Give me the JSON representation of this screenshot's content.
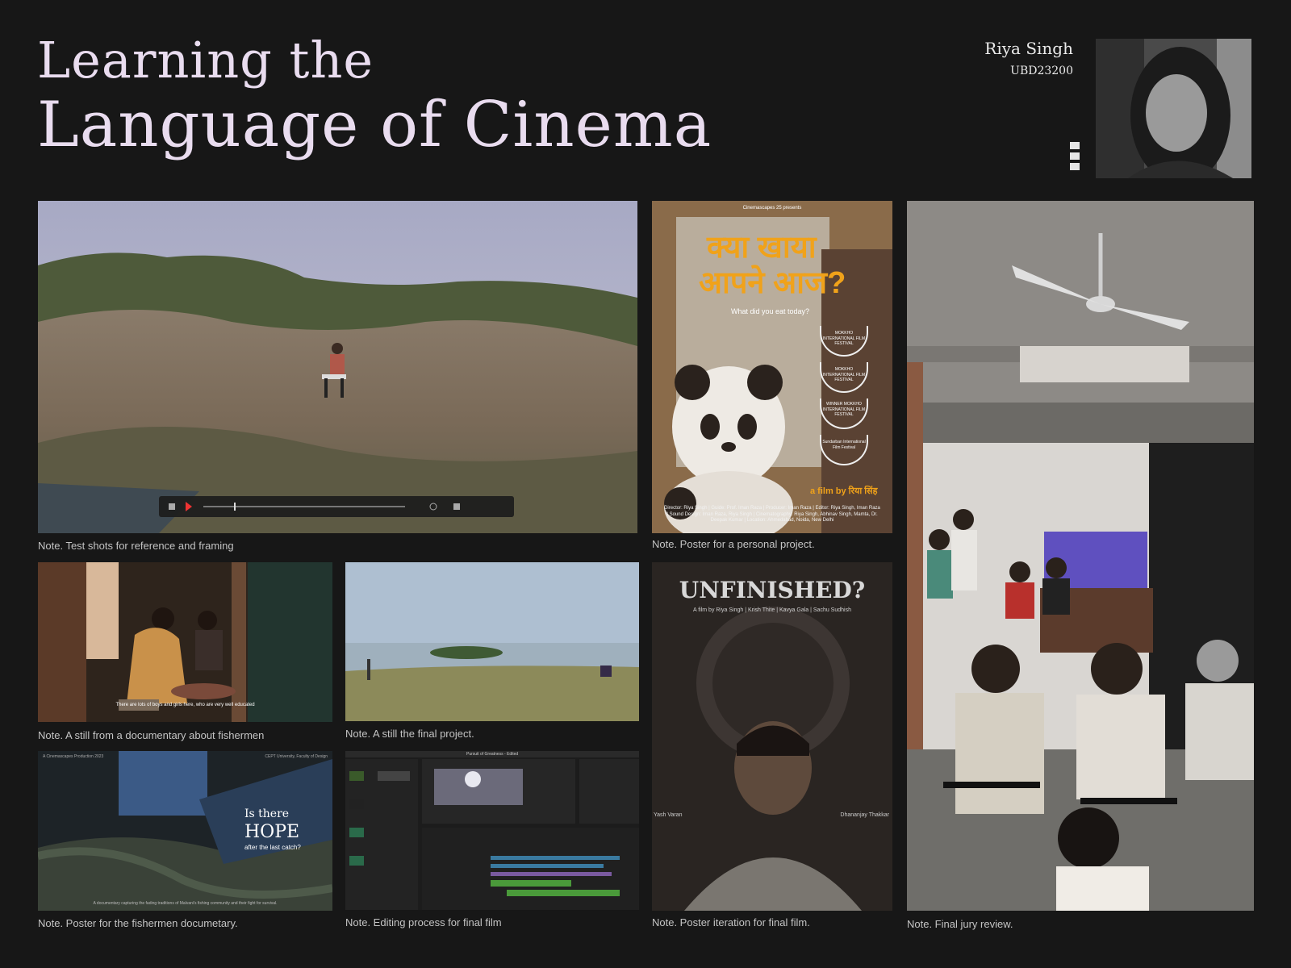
{
  "header": {
    "title_line1": "Learning the",
    "title_line2": "Language of Cinema",
    "author_name": "Riya Singh",
    "author_id": "UBD23200"
  },
  "panels": {
    "test_shots": {
      "caption": "Note. Test shots for reference and framing"
    },
    "poster_personal": {
      "presents": "Cinemascapes 25 presents",
      "hindi_title_line1": "क्या खाया",
      "hindi_title_line2": "आपने आज?",
      "subtitle": "What did you eat today?",
      "laurels": [
        "MOKKHO INTERNATIONAL FILM FESTIVAL",
        "MOKKHO INTERNATIONAL FILM FESTIVAL",
        "WINNER MOKKHO INTERNATIONAL FILM FESTIVAL",
        "Sundarban International Film Festival"
      ],
      "film_by": "a film by रिया सिंह",
      "credits": "Director: Riya Singh | Guide: Prof. Iman Raza | Producer: Iman Raza | Editor: Riya Singh, Iman Raza | Sound Design: Iman Raza, Riya Singh | Cinematography: Riya Singh, Abhinav Singh, Mamta, Dr. Deepak Kumar | Location: Ahmedabad, Noida, New Delhi",
      "caption": "Note. Poster for a personal project."
    },
    "fishermen_still": {
      "subtitle_text": "There are lots of boys and girls here, who are very well educated",
      "caption": "Note. A still from a documentary about fishermen"
    },
    "final_still": {
      "caption": "Note. A still the final project."
    },
    "poster_final": {
      "title": "UNFINISHED?",
      "byline": "A film by Riya Singh | Krish Thite | Kavya Gala | Sachu Sudhish",
      "left_name": "Yash Varan",
      "right_name": "Dhananjay Thakkar",
      "caption": "Note. Poster iteration for final film."
    },
    "poster_fishermen": {
      "top_left": "A Cinemascapes Production 2023",
      "top_right": "CEPT University, Faculty of Design",
      "line1": "Is there",
      "line2": "HOPE",
      "line3": "after the last catch?",
      "bottom": "A documentary capturing the fading traditions of Malvani's fishing community and their fight for survival.",
      "caption": "Note. Poster for the fishermen documetary."
    },
    "editing": {
      "window_title": "Pursuit of Greatness - Edited",
      "caption": "Note. Editing process for final film"
    },
    "jury": {
      "caption": "Note. Final jury review."
    }
  },
  "colors": {
    "background": "#171717",
    "title": "#e9dcef",
    "poster_orange": "#f0a21a"
  }
}
